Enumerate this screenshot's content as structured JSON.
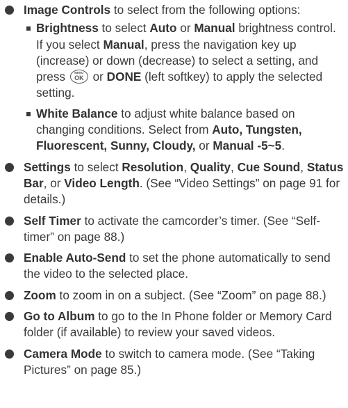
{
  "image_controls": {
    "label": "Image Controls",
    "text": " to select from the following options:",
    "brightness": {
      "label": "Brightness",
      "t1": " to select ",
      "auto": "Auto",
      "t2": " or ",
      "manual": "Manual",
      "t3": " brightness control. If you select ",
      "manual2": "Manual",
      "t4": ", press the navigation key up (increase) or down (decrease) to select a setting, and press ",
      "icon": "menu-ok-key-icon",
      "icon_menu_text": "MENU",
      "icon_ok_text": "OK",
      "t5": " or ",
      "done": "DONE",
      "t6": " (left softkey) to apply the selected setting."
    },
    "white_balance": {
      "label": "White Balance",
      "t1": " to adjust white balance based on changing conditions. Select from ",
      "options": "Auto, Tungsten, Fluorescent, Sunny, Cloudy,",
      "t2": " or ",
      "manual": "Manual -5~5",
      "t3": "."
    }
  },
  "settings": {
    "label": "Settings",
    "t1": " to select ",
    "resolution": "Resolution",
    "c1": ", ",
    "quality": "Quality",
    "c2": ", ",
    "cue_sound": "Cue Sound",
    "c3": ", ",
    "status_bar": "Status Bar",
    "c4": ", or ",
    "video_length": "Video Length",
    "t2": ". (See “Video Settings” on page 91 for details.)"
  },
  "self_timer": {
    "label": "Self Timer",
    "text": " to activate the camcorder’s timer. (See “Self-timer” on page 88.)"
  },
  "enable_auto_send": {
    "label": "Enable Auto-Send",
    "text": " to set the phone automatically to send the video to the selected place."
  },
  "zoom": {
    "label": "Zoom",
    "text": " to zoom in on a subject. (See “Zoom” on page 88.)"
  },
  "go_to_album": {
    "label": "Go to Album",
    "text": " to go to the In Phone folder or Memory Card folder (if available) to review your saved videos."
  },
  "camera_mode": {
    "label": "Camera Mode",
    "text": " to switch to camera mode. (See “Taking Pictures” on page 85.)"
  }
}
